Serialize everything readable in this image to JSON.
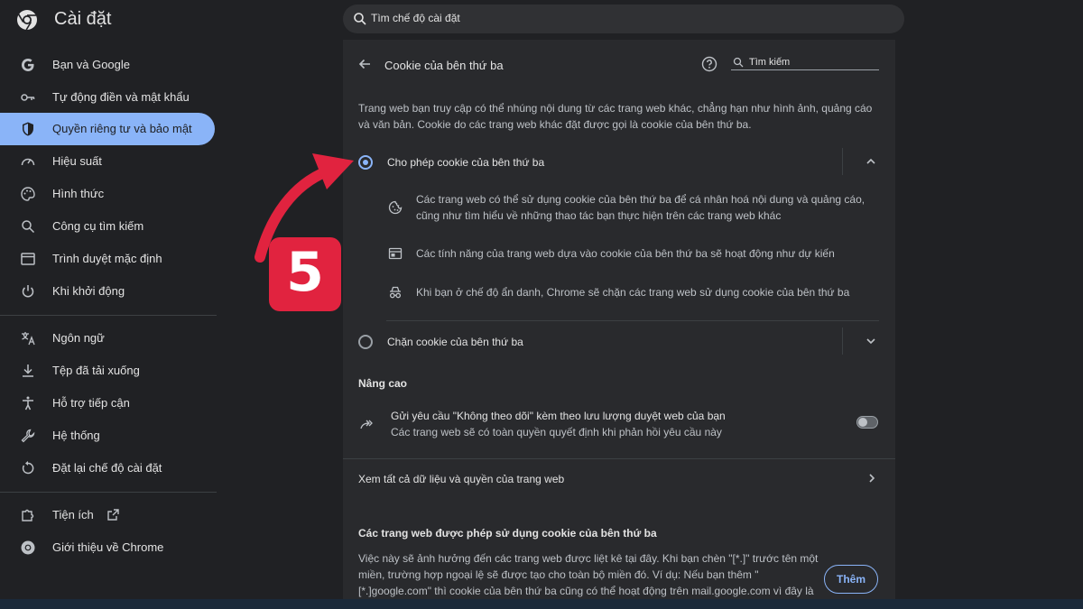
{
  "topbar": {
    "title": "Cài đặt",
    "search_placeholder": "Tìm chế độ cài đặt"
  },
  "sidebar": {
    "items": [
      {
        "label": "Bạn và Google",
        "icon": "google-icon"
      },
      {
        "label": "Tự động điền và mật khẩu",
        "icon": "key-icon"
      },
      {
        "label": "Quyền riêng tư và bảo mật",
        "icon": "shield-icon",
        "active": true
      },
      {
        "label": "Hiệu suất",
        "icon": "speedometer-icon"
      },
      {
        "label": "Hình thức",
        "icon": "palette-icon"
      },
      {
        "label": "Công cụ tìm kiếm",
        "icon": "search-icon"
      },
      {
        "label": "Trình duyệt mặc định",
        "icon": "browser-window-icon"
      },
      {
        "label": "Khi khởi động",
        "icon": "power-icon"
      },
      {
        "label": "Ngôn ngữ",
        "icon": "translate-icon"
      },
      {
        "label": "Tệp đã tải xuống",
        "icon": "download-icon"
      },
      {
        "label": "Hỗ trợ tiếp cận",
        "icon": "accessibility-icon"
      },
      {
        "label": "Hệ thống",
        "icon": "wrench-icon"
      },
      {
        "label": "Đặt lại chế độ cài đặt",
        "icon": "reset-icon"
      },
      {
        "label": "Tiện ích",
        "icon": "puzzle-icon"
      },
      {
        "label": "Giới thiệu về Chrome",
        "icon": "chrome-icon"
      }
    ]
  },
  "card": {
    "title": "Cookie của bên thứ ba",
    "search_label": "Tìm kiếm",
    "description": "Trang web bạn truy cập có thể nhúng nội dung từ các trang web khác, chẳng hạn như hình ảnh, quảng cáo và văn bản. Cookie do các trang web khác đặt được gọi là cookie của bên thứ ba.",
    "option_allow": "Cho phép cookie của bên thứ ba",
    "allow_details": [
      "Các trang web có thể sử dụng cookie của bên thứ ba để cá nhân hoá nội dung và quảng cáo, cũng như tìm hiểu về những thao tác bạn thực hiện trên các trang web khác",
      "Các tính năng của trang web dựa vào cookie của bên thứ ba sẽ hoạt động như dự kiến",
      "Khi bạn ở chế độ ẩn danh, Chrome sẽ chặn các trang web sử dụng cookie của bên thứ ba"
    ],
    "option_block": "Chặn cookie của bên thứ ba",
    "advanced_heading": "Nâng cao",
    "dnt_title": "Gửi yêu cầu \"Không theo dõi\" kèm theo lưu lượng duyệt web của bạn",
    "dnt_subtitle": "Các trang web sẽ có toàn quyền quyết định khi phản hồi yêu cầu này",
    "dnt_enabled": false,
    "site_data_link": "Xem tất cả dữ liệu và quyền của trang web",
    "allowed_heading": "Các trang web được phép sử dụng cookie của bên thứ ba",
    "allowed_description": "Việc này sẽ ảnh hưởng đến các trang web được liệt kê tại đây. Khi bạn chèn \"[*.]\" trước tên một miền, trường hợp ngoại lệ sẽ được tạo cho toàn bộ miền đó. Ví dụ: Nếu bạn thêm \"[*.]google.com\" thì cookie của bên thứ ba cũng có thể hoạt động trên mail.google.com vì đây là",
    "add_button": "Thêm"
  },
  "annotation": {
    "step_number": "5",
    "color": "#e1233f"
  },
  "colors": {
    "accent": "#8ab4f8",
    "background": "#202124",
    "card": "#292a2d"
  }
}
